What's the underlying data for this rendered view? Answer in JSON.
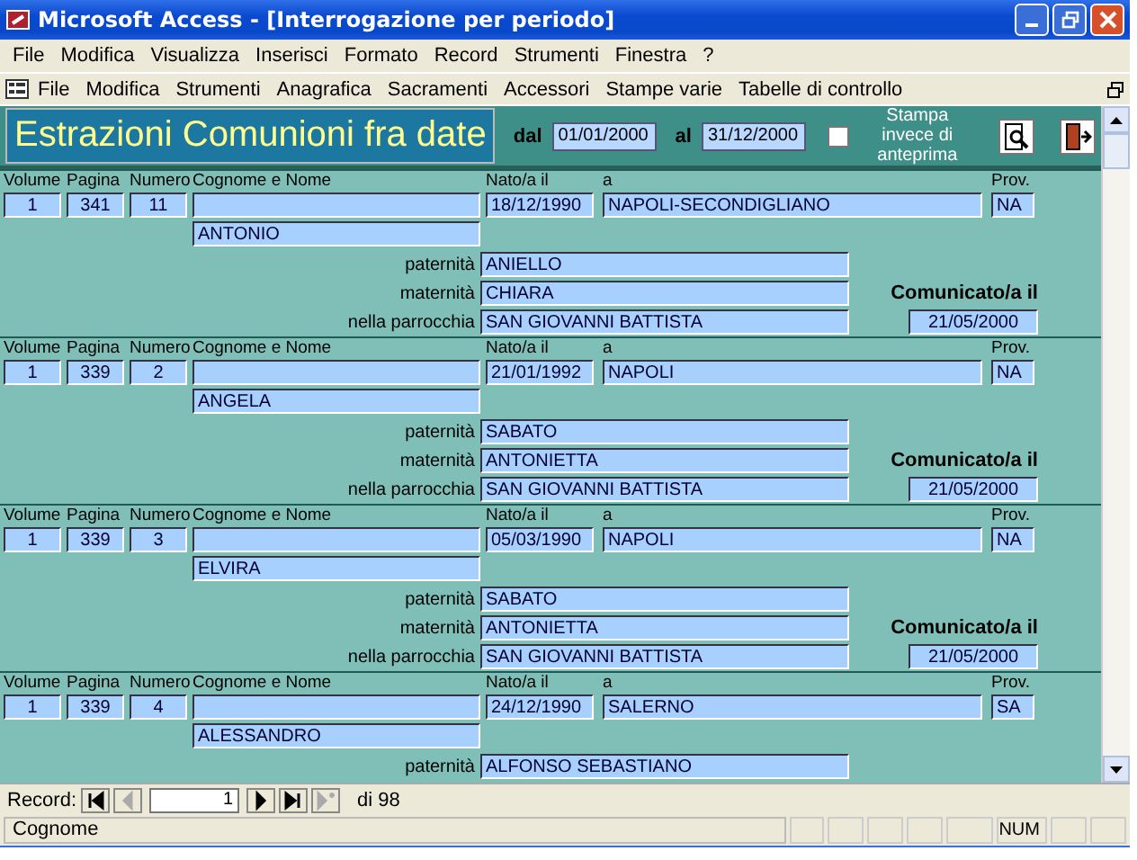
{
  "window": {
    "title": "Microsoft Access - [Interrogazione per periodo]"
  },
  "menu_bar": [
    "File",
    "Modifica",
    "Visualizza",
    "Inserisci",
    "Formato",
    "Record",
    "Strumenti",
    "Finestra",
    "?"
  ],
  "toolbar": [
    "File",
    "Modifica",
    "Strumenti",
    "Anagrafica",
    "Sacramenti",
    "Accessori",
    "Stampe varie",
    "Tabelle di controllo"
  ],
  "form": {
    "title": "Estrazioni Comunioni fra date",
    "from_label": "dal",
    "from_value": "01/01/2000",
    "to_label": "al",
    "to_value": "31/12/2000",
    "print_option": {
      "label": "Stampa invece di anteprima",
      "checked": false
    }
  },
  "records": [
    {
      "headers": [
        "Volume",
        "Pagina",
        "Numero",
        "Cognome e Nome",
        "Nato/a il",
        "a",
        "Prov."
      ],
      "volume": "1",
      "pagina": "341",
      "numero": "11",
      "nome": "ANTONIO",
      "nato_il": "18/12/1990",
      "luogo": "NAPOLI-SECONDIGLIANO",
      "prov": "NA",
      "details": [
        {
          "label": "paternità",
          "value": "ANIELLO"
        },
        {
          "label": "maternità",
          "value": "CHIARA"
        },
        {
          "label": "nella parrocchia",
          "value": "SAN GIOVANNI BATTISTA"
        }
      ],
      "comunicato_label": "Comunicato/a il",
      "comunicato_value": "21/05/2000"
    },
    {
      "headers": [
        "Volume",
        "Pagina",
        "Numero",
        "Cognome e Nome",
        "Nato/a il",
        "a",
        "Prov."
      ],
      "volume": "1",
      "pagina": "339",
      "numero": "2",
      "nome": "ANGELA",
      "nato_il": "21/01/1992",
      "luogo": "NAPOLI",
      "prov": "NA",
      "details": [
        {
          "label": "paternità",
          "value": "SABATO"
        },
        {
          "label": "maternità",
          "value": "ANTONIETTA"
        },
        {
          "label": "nella parrocchia",
          "value": "SAN GIOVANNI BATTISTA"
        }
      ],
      "comunicato_label": "Comunicato/a il",
      "comunicato_value": "21/05/2000"
    },
    {
      "headers": [
        "Volume",
        "Pagina",
        "Numero",
        "Cognome e Nome",
        "Nato/a il",
        "a",
        "Prov."
      ],
      "volume": "1",
      "pagina": "339",
      "numero": "3",
      "nome": "ELVIRA",
      "nato_il": "05/03/1990",
      "luogo": "NAPOLI",
      "prov": "NA",
      "details": [
        {
          "label": "paternità",
          "value": "SABATO"
        },
        {
          "label": "maternità",
          "value": "ANTONIETTA"
        },
        {
          "label": "nella parrocchia",
          "value": "SAN GIOVANNI BATTISTA"
        }
      ],
      "comunicato_label": "Comunicato/a il",
      "comunicato_value": "21/05/2000"
    },
    {
      "headers": [
        "Volume",
        "Pagina",
        "Numero",
        "Cognome e Nome",
        "Nato/a il",
        "a",
        "Prov."
      ],
      "volume": "1",
      "pagina": "339",
      "numero": "4",
      "nome": "ALESSANDRO",
      "nato_il": "24/12/1990",
      "luogo": "SALERNO",
      "prov": "SA",
      "details": [
        {
          "label": "paternità",
          "value": "ALFONSO SEBASTIANO"
        }
      ]
    }
  ],
  "navigation": {
    "label": "Record:",
    "buttons": [
      {
        "kind": "first",
        "disabled": false
      },
      {
        "kind": "prev",
        "disabled": true
      }
    ],
    "current": "1",
    "buttons_after": [
      {
        "kind": "next",
        "disabled": false
      },
      {
        "kind": "last",
        "disabled": false
      },
      {
        "kind": "new",
        "disabled": true
      }
    ],
    "total": "di 98"
  },
  "status_bar": {
    "text": "Cognome",
    "indicator": "NUM"
  }
}
